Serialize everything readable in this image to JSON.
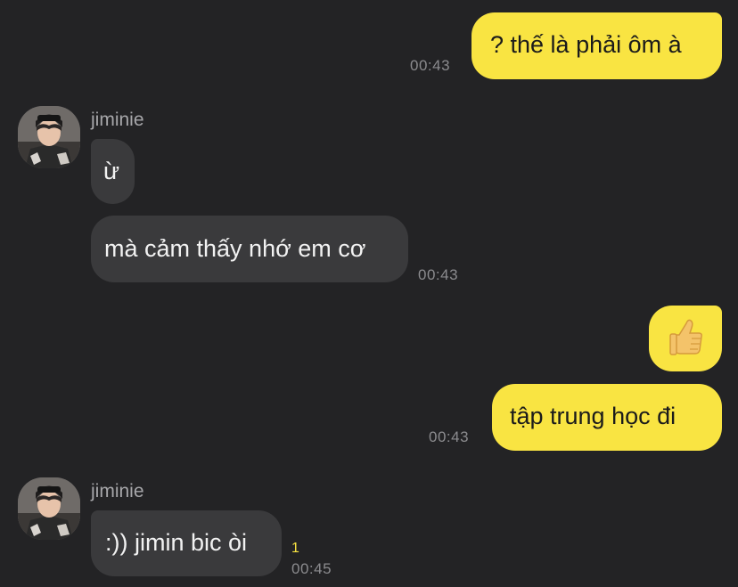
{
  "messages": [
    {
      "id": "m1",
      "dir": "out",
      "text": "? thế là phải ôm à",
      "time": "00:43"
    },
    {
      "id": "m2",
      "dir": "in",
      "sender": "jiminie",
      "text": "ừ"
    },
    {
      "id": "m3",
      "dir": "in",
      "text": "mà cảm thấy nhớ em cơ",
      "time": "00:43"
    },
    {
      "id": "m4",
      "dir": "out",
      "emoji": "👍"
    },
    {
      "id": "m5",
      "dir": "out",
      "text": "tập trung học đi",
      "time": "00:43"
    },
    {
      "id": "m6",
      "dir": "in",
      "sender": "jiminie",
      "text": ":)) jimin bic òi",
      "time": "00:45",
      "unread": "1"
    }
  ],
  "colors": {
    "background": "#232325",
    "outgoing_bubble": "#f9e442",
    "incoming_bubble": "#3a3a3c",
    "unread_count": "#f9e442"
  },
  "icons": {
    "avatar": "profile-photo-avatar",
    "thumbs_up": "thumbs-up-emoji"
  }
}
